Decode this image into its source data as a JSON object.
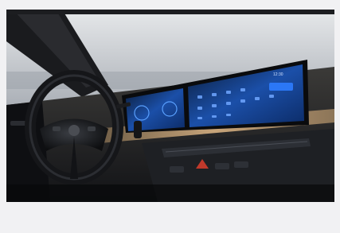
{
  "photo": {
    "subject": "car-interior-dashboard",
    "colors": {
      "sky": "#cfd3d8",
      "trim": "#c8a57a",
      "screen_accent": "#2e7cff",
      "dark": "#0c0e12"
    },
    "screen": {
      "status_time": "12:30"
    }
  }
}
